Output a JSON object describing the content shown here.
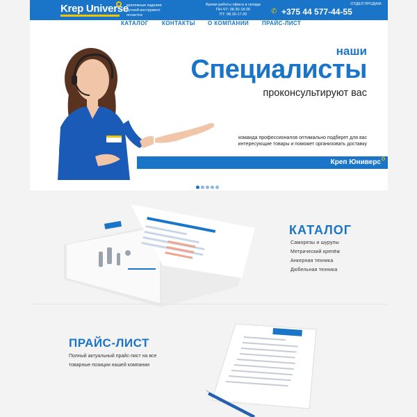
{
  "header": {
    "logo": "Krep Universe",
    "tagline": [
      "крепежные изделия",
      "ручной инструмент",
      "оснастка"
    ],
    "hours": [
      "Время работы офиса и склада",
      "ПН-ЧТ: 08.30-18.00",
      "ПТ: 08.30-17.00"
    ],
    "sales_label": "ОТДЕЛ ПРОДАЖ:",
    "phone": "+375 44 577-44-55"
  },
  "nav": {
    "items": [
      "КАТАЛОГ",
      "КОНТАКТЫ",
      "О КОМПАНИИ",
      "ПРАЙС-ЛИСТ"
    ]
  },
  "hero": {
    "nashi": "наши",
    "title": "Специалисты",
    "subtitle": "проконсультируют вас",
    "description": "команда профессионалов оптимально подберет для вас интересующие товары и поможет организовать доставку",
    "band_brand": "Креп Юниверс",
    "slides": 5,
    "active_slide": 1
  },
  "catalog": {
    "title": "КАТАЛОГ",
    "items": [
      "Саморезы и шурупы",
      "Метрический крепёж",
      "Анкерная техника",
      "Дюбельная техника"
    ]
  },
  "price_list": {
    "title": "ПРАЙС-ЛИСТ",
    "text": "Полный актуальный прайс-лист на все товарные позиции нашей компании"
  },
  "colors": {
    "brand_blue": "#1a74c7",
    "accent_yellow": "#f5c400"
  }
}
